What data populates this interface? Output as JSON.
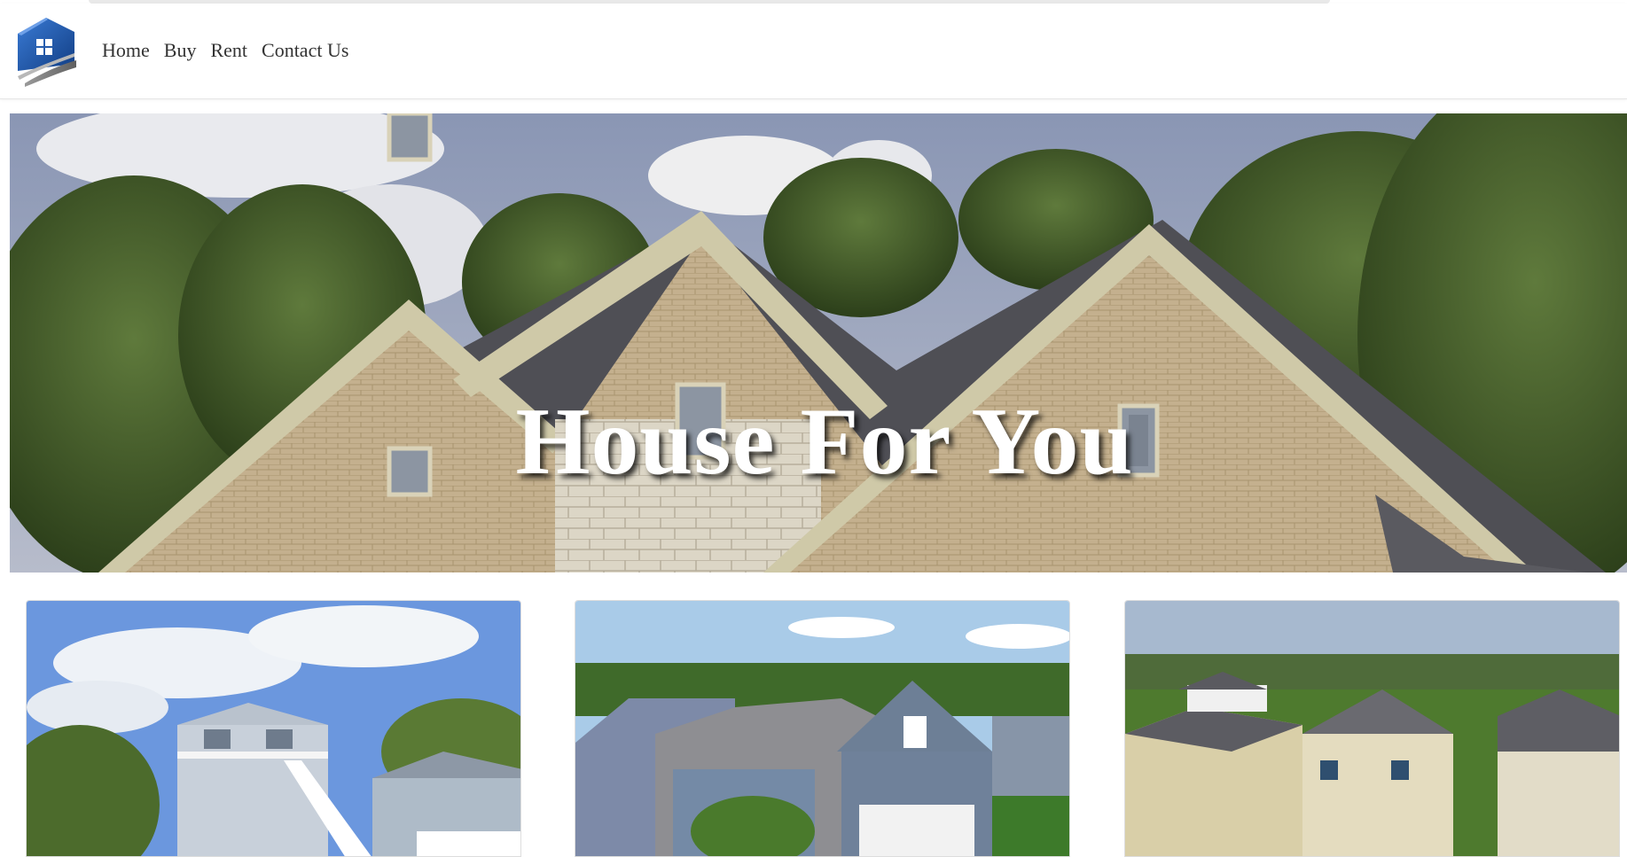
{
  "site": {
    "logo_icon": "house-logo-icon"
  },
  "nav": {
    "items": [
      {
        "label": "Home"
      },
      {
        "label": "Buy"
      },
      {
        "label": "Rent"
      },
      {
        "label": "Contact Us"
      }
    ]
  },
  "hero": {
    "title": "House For You"
  },
  "listings": [
    {
      "image": "listing-photo-raised-house"
    },
    {
      "image": "listing-photo-gray-house"
    },
    {
      "image": "listing-photo-aerial-townhouses"
    }
  ],
  "colors": {
    "logo_blue": "#1e5aa8",
    "nav_text": "#333333",
    "hero_text": "#ffffff"
  }
}
